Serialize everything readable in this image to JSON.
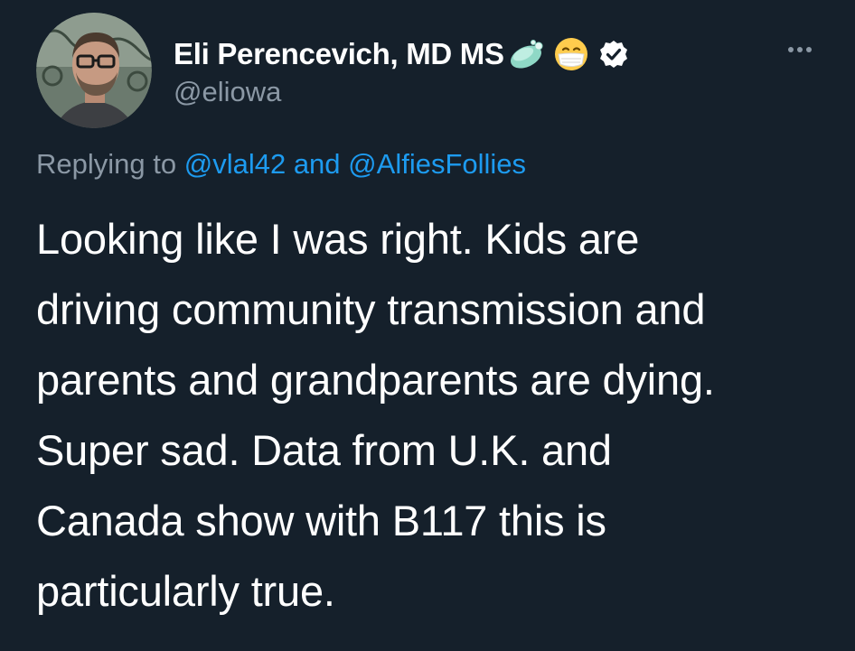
{
  "colors": {
    "background": "#15202b",
    "text_primary": "#ffffff",
    "text_secondary": "#8b98a5",
    "accent_link": "#1d9bf0",
    "verified_badge": "#ffffff"
  },
  "author": {
    "display_name": "Eli Perencevich, MD MS",
    "handle": "@eliowa",
    "avatar_icon": "profile-photo",
    "name_icons": [
      "soap-emoji",
      "face-with-medical-mask-emoji",
      "verified-badge-icon"
    ]
  },
  "more_menu": {
    "icon": "more-horizontal-icon"
  },
  "reply_context": {
    "prefix": "Replying to",
    "mention_1": "@vlal42",
    "connector": "and",
    "mention_2": "@AlfiesFollies"
  },
  "tweet": {
    "lines": [
      "Looking like I was right. Kids are",
      "driving community transmission and",
      "parents and grandparents are dying.",
      "Super sad. Data from U.K. and",
      "Canada show with B117 this is",
      "particularly true."
    ]
  }
}
